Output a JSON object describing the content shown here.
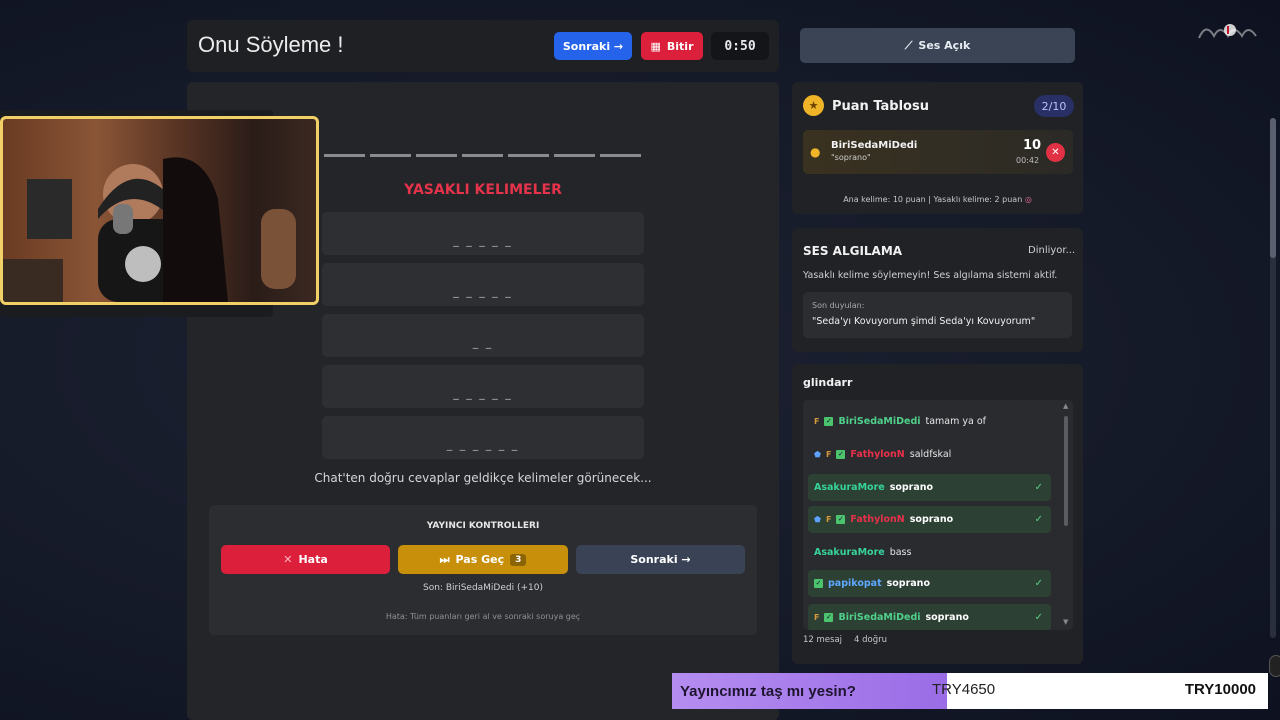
{
  "header": {
    "title": "Onu Söyleme !",
    "next_label": "Sonraki →",
    "finish_label": "Bitir",
    "timer": "0:50"
  },
  "main": {
    "forbidden_title": "YASAKLI KELIMELER",
    "forbidden_words": [
      "_ _ _ _ _",
      "_ _ _ _ _",
      "_ _",
      "_ _ _ _ _",
      "_ _ _ _ _ _"
    ],
    "hint": "Chat'ten doğru cevaplar geldikçe kelimeler görünecek..."
  },
  "controls": {
    "title": "YAYINCI KONTROLLERI",
    "error_label": "Hata",
    "pass_label": "Pas Geç",
    "pass_count": "3",
    "next_label": "Sonraki →",
    "last": "Son: BiriSedaMiDedi (+10)",
    "note": "Hata: Tüm puanları geri al ve sonraki soruya geç"
  },
  "sound_button": "Ses Açık",
  "scoreboard": {
    "title": "Puan Tablosu",
    "count": "2/10",
    "entry": {
      "name": "BiriSedaMiDedi",
      "word": "\"soprano\"",
      "points": "10",
      "time": "00:42"
    },
    "rule": "Ana kelime: 10 puan | Yasaklı kelime: 2 puan"
  },
  "voice": {
    "title": "SES ALGILAMA",
    "status": "Dinliyor...",
    "warning": "Yasaklı kelime söylemeyin! Ses algılama sistemi aktif.",
    "heard_label": "Son duyulan:",
    "heard": "\"Seda'yı Kovuyorum şimdi Seda'yı Kovuyorum\""
  },
  "chat": {
    "title": "glindarr",
    "messages": [
      {
        "user": "BiriSedaMiDedi",
        "text": "tamam ya of",
        "color": "#4fd18b",
        "correct": false
      },
      {
        "user": "FathylonN",
        "text": "saldfskal",
        "color": "#e8304a",
        "correct": false
      },
      {
        "user": "AsakuraMore",
        "text": "soprano",
        "color": "#36d39a",
        "correct": true
      },
      {
        "user": "FathylonN",
        "text": "soprano",
        "color": "#e8304a",
        "correct": true
      },
      {
        "user": "AsakuraMore",
        "text": "bass",
        "color": "#36d39a",
        "correct": false
      },
      {
        "user": "papikopat",
        "text": "soprano",
        "color": "#5ea8ff",
        "correct": true
      },
      {
        "user": "BiriSedaMiDedi",
        "text": "soprano",
        "color": "#4fd18b",
        "correct": true
      }
    ],
    "stats_messages": "12 mesaj",
    "stats_correct": "4 doğru"
  },
  "donation": {
    "question": "Yayıncımız taş mı yesin?",
    "amount": "TRY4650",
    "goal": "TRY10000"
  }
}
